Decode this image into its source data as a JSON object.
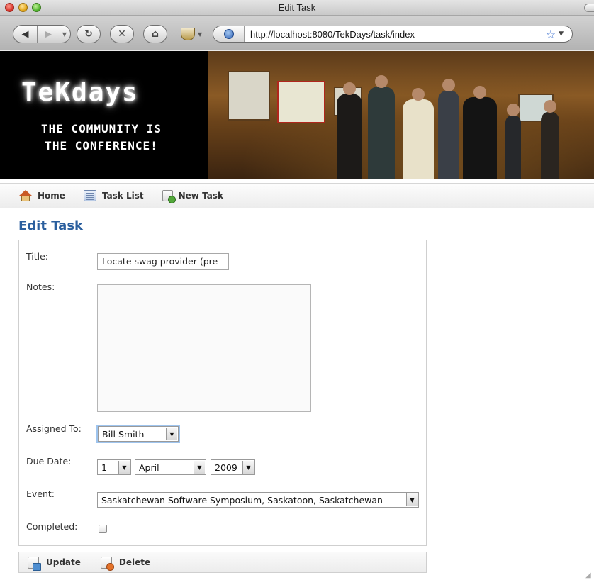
{
  "window": {
    "title": "Edit Task"
  },
  "browser": {
    "url": "http://localhost:8080/TekDays/task/index"
  },
  "banner": {
    "logo": "TeKdays",
    "tagline_line1": "THE COMMUNITY IS",
    "tagline_line2": "THE CONFERENCE!"
  },
  "nav": {
    "home": "Home",
    "task_list": "Task List",
    "new_task": "New Task"
  },
  "page": {
    "heading": "Edit Task"
  },
  "form": {
    "title_label": "Title:",
    "title_value": "Locate swag provider (pre",
    "notes_label": "Notes:",
    "notes_value": "",
    "assigned_label": "Assigned To:",
    "assigned_value": "Bill Smith",
    "due_label": "Due Date:",
    "due_day": "1",
    "due_month": "April",
    "due_year": "2009",
    "event_label": "Event:",
    "event_value": "Saskatchewan Software Symposium, Saskatoon, Saskatchewan",
    "completed_label": "Completed:",
    "completed": false
  },
  "buttons": {
    "update": "Update",
    "delete": "Delete"
  }
}
